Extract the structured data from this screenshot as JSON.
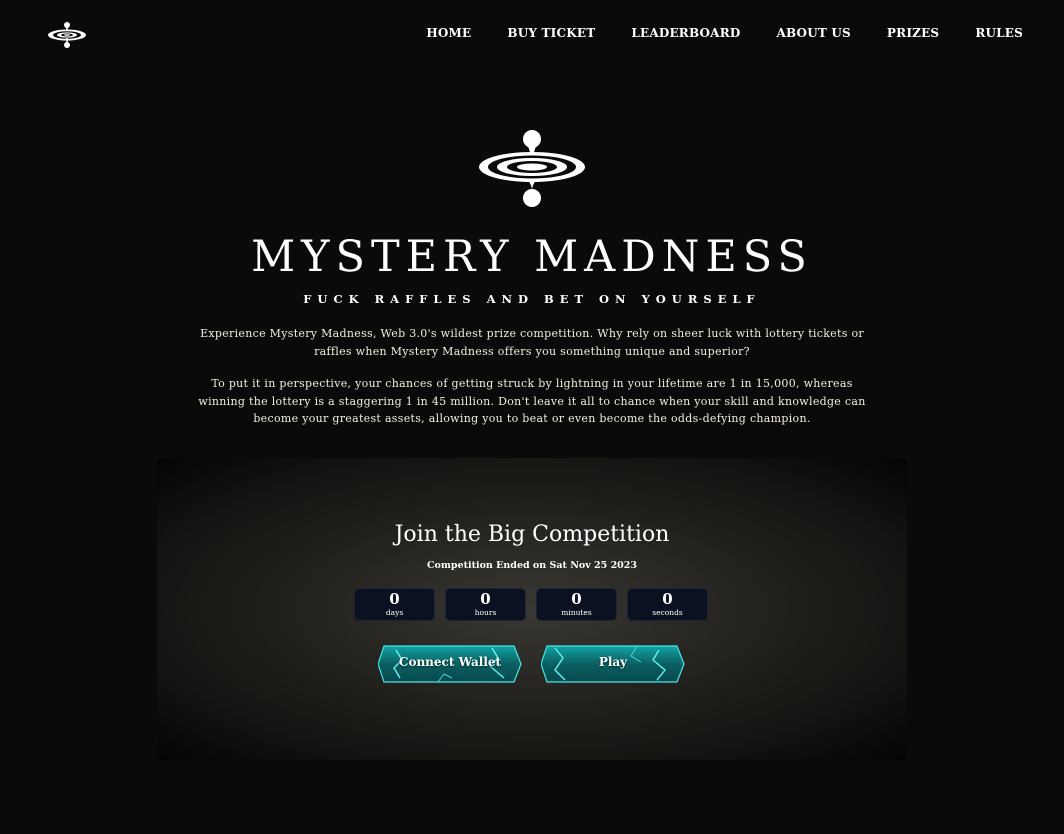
{
  "nav": {
    "logo_icon": "ripple-drop-icon",
    "items": [
      {
        "label": "HOME"
      },
      {
        "label": "BUY TICKET"
      },
      {
        "label": "LEADERBOARD"
      },
      {
        "label": "ABOUT US"
      },
      {
        "label": "PRIZES"
      },
      {
        "label": "RULES"
      }
    ]
  },
  "hero": {
    "logo_icon": "ripple-drop-icon",
    "title": "MYSTERY MADNESS",
    "subtitle": "FUCK RAFFLES AND BET ON YOURSELF",
    "paragraph1": "Experience Mystery Madness, Web 3.0's wildest prize competition. Why rely on sheer luck with lottery tickets or raffles when Mystery Madness offers you something unique and superior?",
    "paragraph2": "To put it in perspective, your chances of getting struck by lightning in your lifetime are 1 in 15,000, whereas winning the lottery is a staggering 1 in 45 million. Don't leave it all to chance when your skill and knowledge can become your greatest assets, allowing you to beat or even become the odds-defying champion."
  },
  "competition": {
    "title": "Join the Big Competition",
    "status": "Competition Ended on Sat Nov 25 2023",
    "countdown": [
      {
        "value": "0",
        "label": "days"
      },
      {
        "value": "0",
        "label": "hours"
      },
      {
        "value": "0",
        "label": "minutes"
      },
      {
        "value": "0",
        "label": "seconds"
      }
    ],
    "connect_label": "Connect Wallet",
    "play_label": "Play"
  },
  "colors": {
    "background": "#0a0a0a",
    "countdown_box": "#0b1120",
    "button_teal": "#0e6f6f",
    "button_glow": "#2ee6e6"
  }
}
